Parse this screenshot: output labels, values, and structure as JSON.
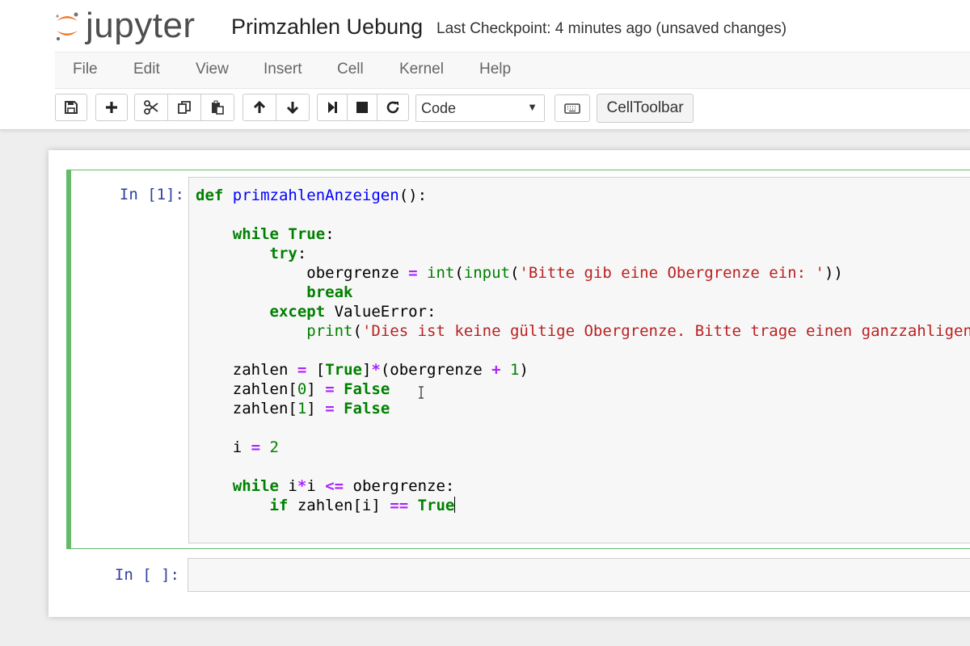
{
  "header": {
    "logo_text": "jupyter",
    "notebook_name": "Primzahlen Uebung",
    "checkpoint": "Last Checkpoint: 4 minutes ago (unsaved changes)"
  },
  "menu": [
    "File",
    "Edit",
    "View",
    "Insert",
    "Cell",
    "Kernel",
    "Help"
  ],
  "toolbar": {
    "icons": [
      "save-icon",
      "plus-icon",
      "cut-icon",
      "copy-icon",
      "paste-icon",
      "arrow-up-icon",
      "arrow-down-icon",
      "step-forward-icon",
      "stop-icon",
      "refresh-icon",
      "keyboard-icon"
    ],
    "cell_type": "Code",
    "celltoolbar_label": "CellToolbar"
  },
  "cells": [
    {
      "prompt": "In [1]:",
      "lines": [
        "def primzahlenAnzeigen():",
        "",
        "    while True:",
        "        try:",
        "            obergrenze = int(input('Bitte gib eine Obergrenze ein: '))",
        "            break",
        "        except ValueError:",
        "            print('Dies ist keine gültige Obergrenze. Bitte trage einen ganzzahligen W",
        "",
        "    zahlen = [True]*(obergrenze + 1)",
        "    zahlen[0] = False",
        "    zahlen[1] = False",
        "",
        "    i = 2",
        "",
        "    while i*i <= obergrenze:",
        "        if zahlen[i] == True"
      ]
    },
    {
      "prompt": "In [ ]:",
      "lines": []
    }
  ],
  "colors": {
    "keyword": "#008000",
    "function_name": "#0000ff",
    "string": "#ba2121",
    "operator": "#aa22ff",
    "prompt": "#303f9f",
    "selected_cell_border": "#66bb6a",
    "logo_orange": "#f37726"
  }
}
